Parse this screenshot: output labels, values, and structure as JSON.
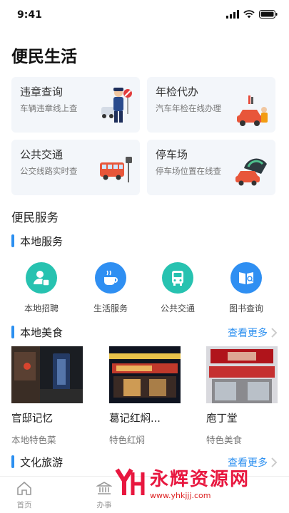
{
  "status": {
    "time": "9:41"
  },
  "page": {
    "title": "便民生活"
  },
  "cards": [
    {
      "title": "违章查询",
      "subtitle": "车辆违章线上查",
      "art": "police-officer-car-icon"
    },
    {
      "title": "年检代办",
      "subtitle": "汽车年检在线办理",
      "art": "car-repair-icon"
    },
    {
      "title": "公共交通",
      "subtitle": "公交线路实时查",
      "art": "bus-stop-icon"
    },
    {
      "title": "停车场",
      "subtitle": "停车场位置在线查",
      "art": "parking-car-icon"
    }
  ],
  "services_section": {
    "title": "便民服务"
  },
  "local_services": {
    "heading": "本地服务",
    "items": [
      {
        "label": "本地招聘",
        "icon": "recruit-icon",
        "color": "#27c2b0"
      },
      {
        "label": "生活服务",
        "icon": "coffee-cup-icon",
        "color": "#2f8ff2"
      },
      {
        "label": "公共交通",
        "icon": "bus-icon",
        "color": "#27c2b0"
      },
      {
        "label": "图书查询",
        "icon": "book-search-icon",
        "color": "#2f8ff2"
      }
    ]
  },
  "local_food": {
    "heading": "本地美食",
    "see_more": "查看更多",
    "items": [
      {
        "name": "官邸记忆",
        "desc": "本地特色菜"
      },
      {
        "name": "葛记红焖...",
        "desc": "特色红焖"
      },
      {
        "name": "庖丁堂",
        "desc": "特色美食"
      }
    ]
  },
  "tourism": {
    "heading": "文化旅游",
    "see_more": "查看更多"
  },
  "tabs": [
    {
      "label": "首页",
      "icon": "home-icon"
    },
    {
      "label": "办事",
      "icon": "government-building-icon"
    }
  ],
  "watermark": {
    "text": "永辉资源网",
    "url": "www.yhkjjj.com"
  },
  "colors": {
    "accent": "#2b8ff0",
    "card_bg": "#f3f6fa",
    "watermark": "#e8173f"
  }
}
